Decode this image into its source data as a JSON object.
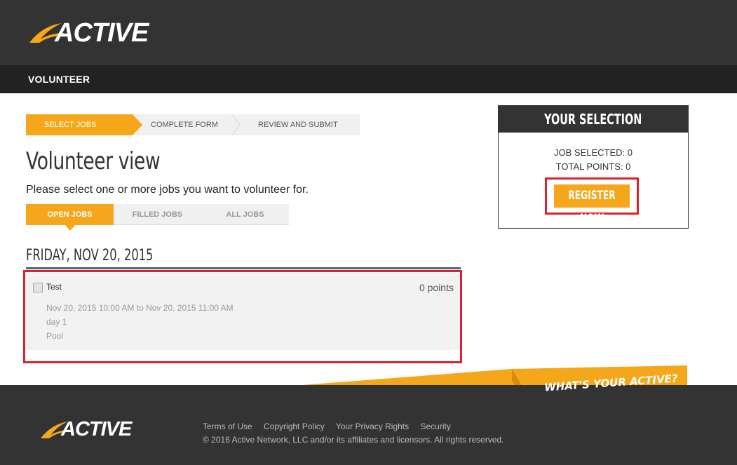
{
  "header": {
    "logo_text": "ACTIVE",
    "section_title": "VOLUNTEER"
  },
  "steps": [
    {
      "label": "SELECT JOBS",
      "active": true
    },
    {
      "label": "COMPLETE FORM",
      "active": false
    },
    {
      "label": "REVIEW AND SUBMIT",
      "active": false
    }
  ],
  "main": {
    "title": "Volunteer view",
    "subtitle": "Please select one or more jobs you want to volunteer for.",
    "tabs": [
      {
        "label": "OPEN JOBS",
        "active": true
      },
      {
        "label": "FILLED JOBS",
        "active": false
      },
      {
        "label": "ALL JOBS",
        "active": false
      }
    ],
    "date_heading": "FRIDAY, NOV 20, 2015",
    "job": {
      "name": "Test",
      "points": "0 points",
      "time": "Nov 20, 2015 10:00 AM to Nov 20, 2015 11:00 AM",
      "day": "day 1",
      "location": "Pool",
      "checked": false
    }
  },
  "selection": {
    "title": "YOUR SELECTION",
    "job_selected": "JOB SELECTED: 0",
    "total_points": "TOTAL POINTS: 0",
    "register_label": "REGISTER NOW"
  },
  "footer": {
    "slogan": "WHAT'S YOUR ACTIVE?",
    "logo_text": "ACTIVE",
    "links": [
      "Terms of Use",
      "Copyright Policy",
      "Your Privacy Rights",
      "Security"
    ],
    "copyright": "© 2016 Active Network, LLC and/or its affiliates and licensors. All rights reserved."
  },
  "colors": {
    "accent": "#f5a71c",
    "dark": "#333333",
    "highlight": "#e0202a",
    "rule": "#3d6e8f"
  }
}
